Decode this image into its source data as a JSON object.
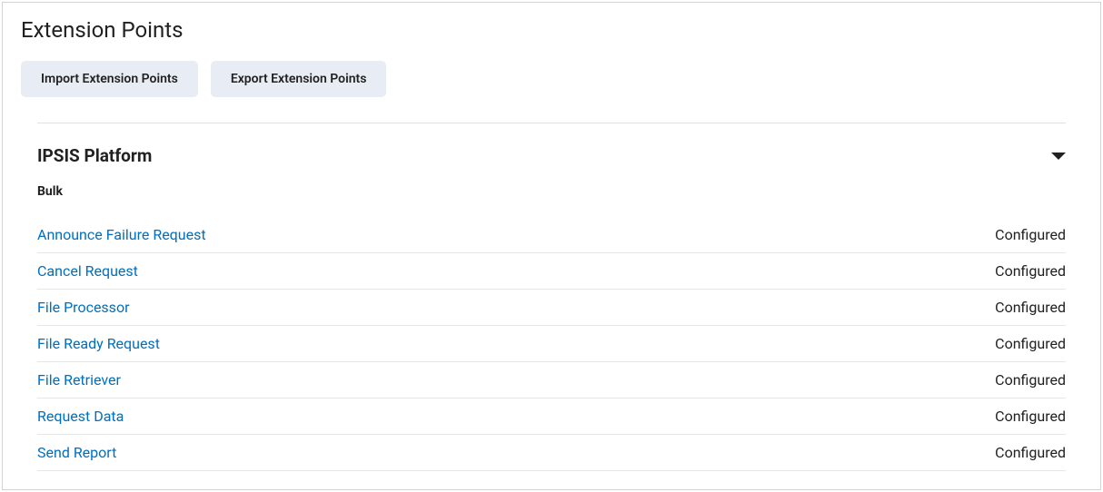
{
  "page": {
    "title": "Extension Points"
  },
  "toolbar": {
    "import_label": "Import Extension Points",
    "export_label": "Export Extension Points"
  },
  "section": {
    "title": "IPSIS Platform",
    "subsection_title": "Bulk",
    "items": [
      {
        "label": "Announce Failure Request",
        "status": "Configured"
      },
      {
        "label": "Cancel Request",
        "status": "Configured"
      },
      {
        "label": "File Processor",
        "status": "Configured"
      },
      {
        "label": "File Ready Request",
        "status": "Configured"
      },
      {
        "label": "File Retriever",
        "status": "Configured"
      },
      {
        "label": "Request Data",
        "status": "Configured"
      },
      {
        "label": "Send Report",
        "status": "Configured"
      }
    ]
  }
}
